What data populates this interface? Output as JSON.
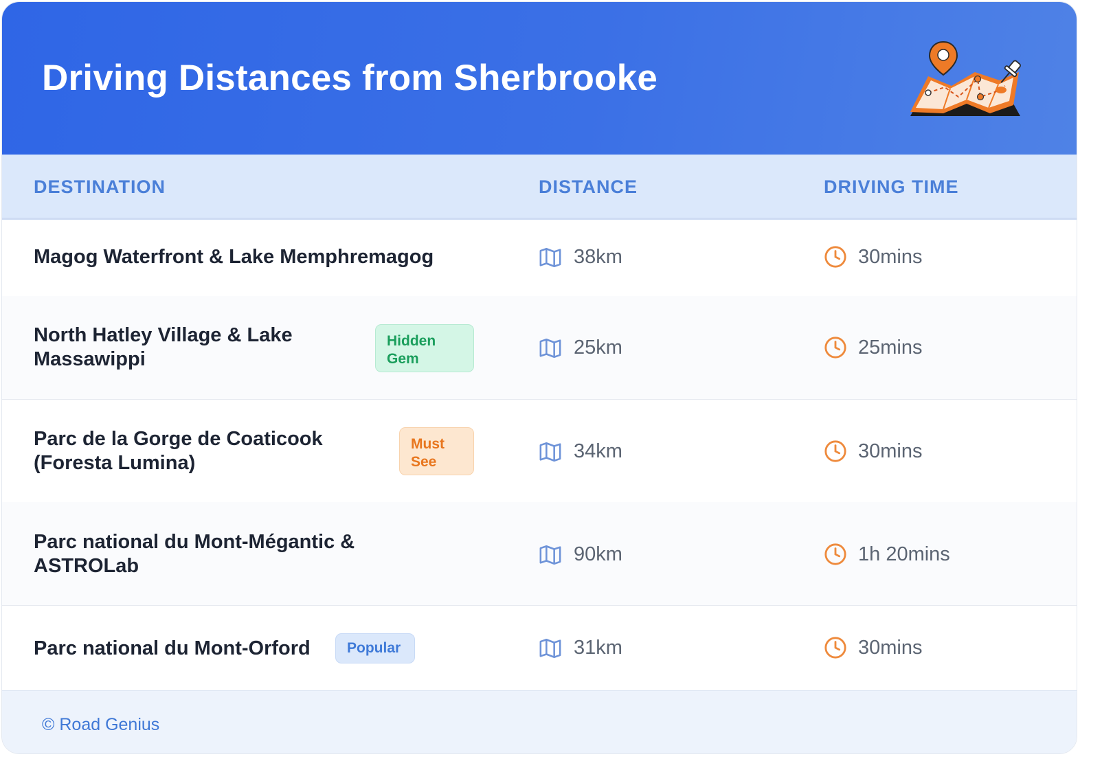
{
  "title": "Driving Distances from Sherbrooke",
  "columns": {
    "destination": "DESTINATION",
    "distance": "DISTANCE",
    "driving_time": "DRIVING TIME"
  },
  "rows": [
    {
      "destination": "Magog Waterfront & Lake Memphremagog",
      "badge": "",
      "distance": "38km",
      "time": "30mins"
    },
    {
      "destination": "North Hatley Village & Lake Massawippi",
      "badge": "Hidden Gem",
      "distance": "25km",
      "time": "25mins"
    },
    {
      "destination": "Parc de la Gorge de Coaticook (Foresta Lumina)",
      "badge": "Must See",
      "distance": "34km",
      "time": "30mins"
    },
    {
      "destination": "Parc national du Mont-Mégantic & ASTROLab",
      "badge": "",
      "distance": "90km",
      "time": "1h 20mins"
    },
    {
      "destination": "Parc national du Mont-Orford",
      "badge": "Popular",
      "distance": "31km",
      "time": "30mins"
    }
  ],
  "footer": "© Road Genius",
  "icons": {
    "header_illustration": "map-with-pins-illustration",
    "distance": "map-icon",
    "time": "clock-icon"
  },
  "colors": {
    "header": "#2f66e6",
    "accent_blue": "#4a7fd8",
    "hidden_gem": "#1a9e5c",
    "must_see": "#e8761e",
    "popular": "#3f7ad8",
    "clock": "#ee8a3c",
    "map": "#6e93d8"
  }
}
